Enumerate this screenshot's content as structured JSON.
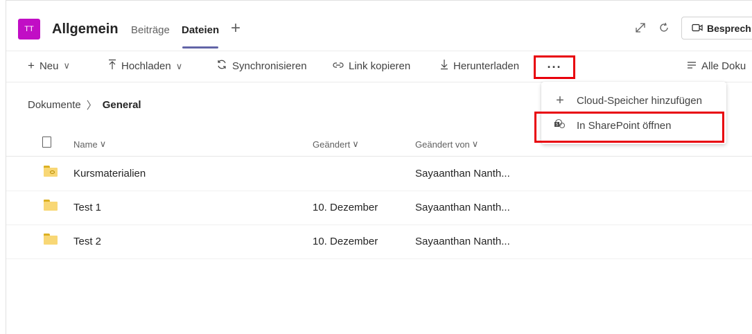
{
  "header": {
    "team_avatar": "TT",
    "team_name": "Allgemein",
    "tabs": [
      {
        "label": "Beiträge",
        "active": false
      },
      {
        "label": "Dateien",
        "active": true
      }
    ],
    "meet_label": "Besprech",
    "icons": [
      "add-tab-icon",
      "expand-icon",
      "refresh-icon",
      "video-icon"
    ]
  },
  "toolbar": {
    "new_label": "Neu",
    "upload_label": "Hochladen",
    "sync_label": "Synchronisieren",
    "copy_link_label": "Link kopieren",
    "download_label": "Herunterladen",
    "more_label": "···",
    "all_docs_label": "Alle Doku"
  },
  "breadcrumb": {
    "root": "Dokumente",
    "current": "General"
  },
  "table": {
    "columns": [
      "Name",
      "Geändert",
      "Geändert von"
    ],
    "rows": [
      {
        "name": "Kursmaterialien",
        "modified": "",
        "modified_by": "Sayaanthan Nanth...",
        "shared": true
      },
      {
        "name": "Test 1",
        "modified": "10. Dezember",
        "modified_by": "Sayaanthan Nanth...",
        "shared": false
      },
      {
        "name": "Test 2",
        "modified": "10. Dezember",
        "modified_by": "Sayaanthan Nanth...",
        "shared": false
      }
    ]
  },
  "menu": {
    "items": [
      {
        "label": "Cloud-Speicher hinzufügen",
        "icon": "plus-icon"
      },
      {
        "label": "In SharePoint öffnen",
        "icon": "sharepoint-icon"
      }
    ]
  },
  "colors": {
    "accent": "#6264a7",
    "avatar": "#c10ec5",
    "highlight": "#e8000b",
    "folder": "#f8d775"
  }
}
